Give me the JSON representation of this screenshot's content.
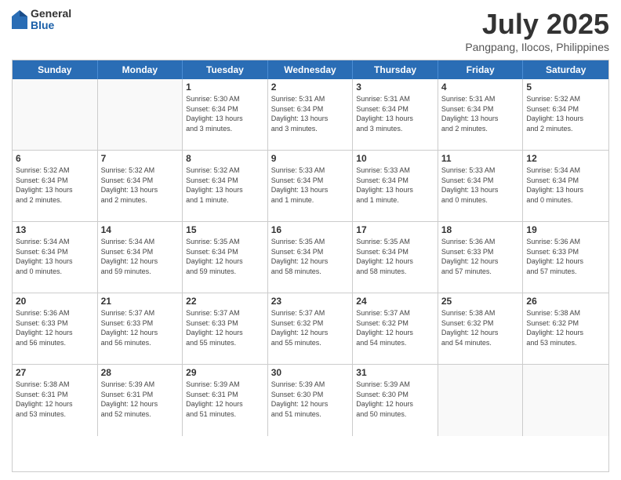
{
  "header": {
    "logo": {
      "general": "General",
      "blue": "Blue"
    },
    "title": "July 2025",
    "location": "Pangpang, Ilocos, Philippines"
  },
  "calendar": {
    "weekdays": [
      "Sunday",
      "Monday",
      "Tuesday",
      "Wednesday",
      "Thursday",
      "Friday",
      "Saturday"
    ],
    "rows": [
      [
        {
          "day": "",
          "detail": ""
        },
        {
          "day": "",
          "detail": ""
        },
        {
          "day": "1",
          "detail": "Sunrise: 5:30 AM\nSunset: 6:34 PM\nDaylight: 13 hours\nand 3 minutes."
        },
        {
          "day": "2",
          "detail": "Sunrise: 5:31 AM\nSunset: 6:34 PM\nDaylight: 13 hours\nand 3 minutes."
        },
        {
          "day": "3",
          "detail": "Sunrise: 5:31 AM\nSunset: 6:34 PM\nDaylight: 13 hours\nand 3 minutes."
        },
        {
          "day": "4",
          "detail": "Sunrise: 5:31 AM\nSunset: 6:34 PM\nDaylight: 13 hours\nand 2 minutes."
        },
        {
          "day": "5",
          "detail": "Sunrise: 5:32 AM\nSunset: 6:34 PM\nDaylight: 13 hours\nand 2 minutes."
        }
      ],
      [
        {
          "day": "6",
          "detail": "Sunrise: 5:32 AM\nSunset: 6:34 PM\nDaylight: 13 hours\nand 2 minutes."
        },
        {
          "day": "7",
          "detail": "Sunrise: 5:32 AM\nSunset: 6:34 PM\nDaylight: 13 hours\nand 2 minutes."
        },
        {
          "day": "8",
          "detail": "Sunrise: 5:32 AM\nSunset: 6:34 PM\nDaylight: 13 hours\nand 1 minute."
        },
        {
          "day": "9",
          "detail": "Sunrise: 5:33 AM\nSunset: 6:34 PM\nDaylight: 13 hours\nand 1 minute."
        },
        {
          "day": "10",
          "detail": "Sunrise: 5:33 AM\nSunset: 6:34 PM\nDaylight: 13 hours\nand 1 minute."
        },
        {
          "day": "11",
          "detail": "Sunrise: 5:33 AM\nSunset: 6:34 PM\nDaylight: 13 hours\nand 0 minutes."
        },
        {
          "day": "12",
          "detail": "Sunrise: 5:34 AM\nSunset: 6:34 PM\nDaylight: 13 hours\nand 0 minutes."
        }
      ],
      [
        {
          "day": "13",
          "detail": "Sunrise: 5:34 AM\nSunset: 6:34 PM\nDaylight: 13 hours\nand 0 minutes."
        },
        {
          "day": "14",
          "detail": "Sunrise: 5:34 AM\nSunset: 6:34 PM\nDaylight: 12 hours\nand 59 minutes."
        },
        {
          "day": "15",
          "detail": "Sunrise: 5:35 AM\nSunset: 6:34 PM\nDaylight: 12 hours\nand 59 minutes."
        },
        {
          "day": "16",
          "detail": "Sunrise: 5:35 AM\nSunset: 6:34 PM\nDaylight: 12 hours\nand 58 minutes."
        },
        {
          "day": "17",
          "detail": "Sunrise: 5:35 AM\nSunset: 6:34 PM\nDaylight: 12 hours\nand 58 minutes."
        },
        {
          "day": "18",
          "detail": "Sunrise: 5:36 AM\nSunset: 6:33 PM\nDaylight: 12 hours\nand 57 minutes."
        },
        {
          "day": "19",
          "detail": "Sunrise: 5:36 AM\nSunset: 6:33 PM\nDaylight: 12 hours\nand 57 minutes."
        }
      ],
      [
        {
          "day": "20",
          "detail": "Sunrise: 5:36 AM\nSunset: 6:33 PM\nDaylight: 12 hours\nand 56 minutes."
        },
        {
          "day": "21",
          "detail": "Sunrise: 5:37 AM\nSunset: 6:33 PM\nDaylight: 12 hours\nand 56 minutes."
        },
        {
          "day": "22",
          "detail": "Sunrise: 5:37 AM\nSunset: 6:33 PM\nDaylight: 12 hours\nand 55 minutes."
        },
        {
          "day": "23",
          "detail": "Sunrise: 5:37 AM\nSunset: 6:32 PM\nDaylight: 12 hours\nand 55 minutes."
        },
        {
          "day": "24",
          "detail": "Sunrise: 5:37 AM\nSunset: 6:32 PM\nDaylight: 12 hours\nand 54 minutes."
        },
        {
          "day": "25",
          "detail": "Sunrise: 5:38 AM\nSunset: 6:32 PM\nDaylight: 12 hours\nand 54 minutes."
        },
        {
          "day": "26",
          "detail": "Sunrise: 5:38 AM\nSunset: 6:32 PM\nDaylight: 12 hours\nand 53 minutes."
        }
      ],
      [
        {
          "day": "27",
          "detail": "Sunrise: 5:38 AM\nSunset: 6:31 PM\nDaylight: 12 hours\nand 53 minutes."
        },
        {
          "day": "28",
          "detail": "Sunrise: 5:39 AM\nSunset: 6:31 PM\nDaylight: 12 hours\nand 52 minutes."
        },
        {
          "day": "29",
          "detail": "Sunrise: 5:39 AM\nSunset: 6:31 PM\nDaylight: 12 hours\nand 51 minutes."
        },
        {
          "day": "30",
          "detail": "Sunrise: 5:39 AM\nSunset: 6:30 PM\nDaylight: 12 hours\nand 51 minutes."
        },
        {
          "day": "31",
          "detail": "Sunrise: 5:39 AM\nSunset: 6:30 PM\nDaylight: 12 hours\nand 50 minutes."
        },
        {
          "day": "",
          "detail": ""
        },
        {
          "day": "",
          "detail": ""
        }
      ]
    ]
  }
}
